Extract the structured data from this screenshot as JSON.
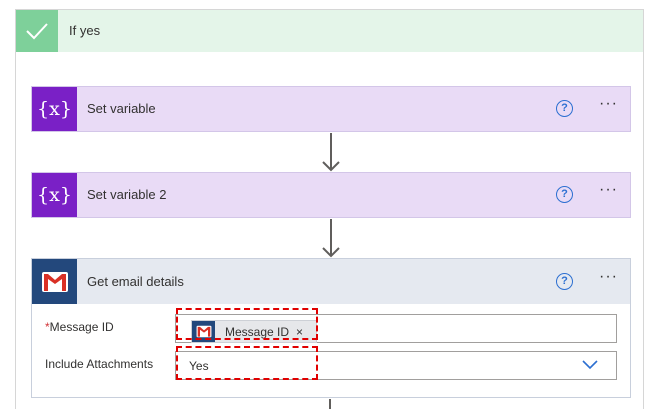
{
  "branch": {
    "title": "If yes",
    "icon": "checkmark-icon",
    "color": "#7ed09a"
  },
  "actions": [
    {
      "title": "Set variable",
      "icon": "variable-icon",
      "icon_text": "{x}",
      "help": "?",
      "more": "···"
    },
    {
      "title": "Set variable 2",
      "icon": "variable-icon",
      "icon_text": "{x}",
      "help": "?",
      "more": "···"
    }
  ],
  "gmail_action": {
    "title": "Get email details",
    "icon": "gmail-icon",
    "help": "?",
    "more": "···",
    "fields": {
      "message_id": {
        "required_mark": "*",
        "label": "Message ID",
        "token": "Message ID",
        "token_remove": "×"
      },
      "include_attachments": {
        "label": "Include Attachments",
        "value": "Yes"
      }
    }
  },
  "colors": {
    "variable_accent": "#7a20c6",
    "gmail_accent": "#23487c",
    "highlight": "#e00000",
    "help_blue": "#2c6fd1"
  }
}
